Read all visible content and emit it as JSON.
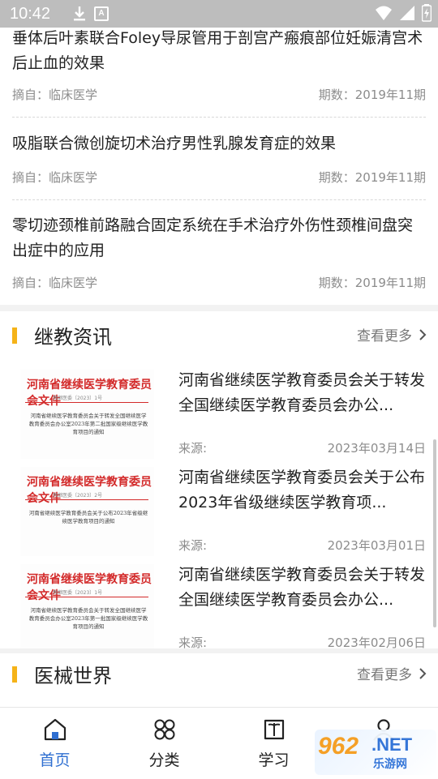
{
  "status_bar": {
    "time": "10:42",
    "icons": [
      "download-icon",
      "a-badge-icon",
      "wifi-icon",
      "signal-icon",
      "battery-icon"
    ]
  },
  "articles": [
    {
      "title": "垂体后叶素联合Foley导尿管用于剖宫产瘢痕部位妊娠清宫术后止血的效果",
      "source": "摘自：临床医学",
      "issue": "期数：2019年11期"
    },
    {
      "title": "吸脂联合微创旋切术治疗男性乳腺发育症的效果",
      "source": "摘自：临床医学",
      "issue": "期数：2019年11期"
    },
    {
      "title": "零切迹颈椎前路融合固定系统在手术治疗外伤性颈椎间盘突出症中的应用",
      "source": "摘自：临床医学",
      "issue": "期数：2019年11期"
    }
  ],
  "sections": {
    "continuing_edu": {
      "title": "继教资讯",
      "more": "查看更多"
    },
    "device_world": {
      "title": "医械世界",
      "more": "查看更多"
    }
  },
  "news": [
    {
      "thumb_head": "河南省继续医学教育委员会文件",
      "thumb_no": "豫继医委〔2023〕1号",
      "thumb_body": "河南省继续医学教育委员会关于转发全国继续医学教育委员会办公室2023年第二批国家级继续医学教育项目的通知",
      "title": "河南省继续医学教育委员会关于转发全国继续医学教育委员会办公...",
      "source": "来源:",
      "date": "2023年03月14日"
    },
    {
      "thumb_head": "河南省继续医学教育委员会文件",
      "thumb_no": "豫继医委〔2023〕2号",
      "thumb_body": "河南省继续医学教育委员会关于公布2023年省级继续医学教育项目的通知",
      "title": "河南省继续医学教育委员会关于公布2023年省级继续医学教育项...",
      "source": "来源:",
      "date": "2023年03月01日"
    },
    {
      "thumb_head": "河南省继续医学教育委员会文件",
      "thumb_no": "豫继医委〔2023〕1号",
      "thumb_body": "河南省继续医学教育委员会关于转发全国继续医学教育委员会办公室2023年第一批国家级继续医学教育项目的通知",
      "title": "河南省继续医学教育委员会关于转发全国继续医学教育委员会办公...",
      "source": "来源:",
      "date": "2023年02月06日"
    }
  ],
  "bottom_nav": [
    {
      "label": "首页",
      "icon": "home-icon",
      "active": true
    },
    {
      "label": "分类",
      "icon": "grid-icon",
      "active": false
    },
    {
      "label": "学习",
      "icon": "book-icon",
      "active": false
    },
    {
      "label": "",
      "icon": "person-icon",
      "active": false
    }
  ],
  "watermark": {
    "logo": "962",
    "net": ".NET",
    "cn": "乐游网"
  },
  "colors": {
    "accent": "#f5b318",
    "active": "#2f6fd1",
    "doc_red": "#d32a2a"
  }
}
